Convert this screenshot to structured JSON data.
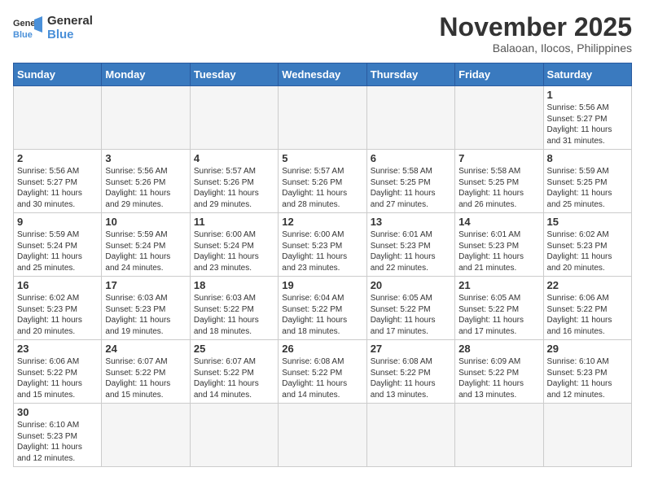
{
  "header": {
    "logo_general": "General",
    "logo_blue": "Blue",
    "month_year": "November 2025",
    "location": "Balaoan, Ilocos, Philippines"
  },
  "weekdays": [
    "Sunday",
    "Monday",
    "Tuesday",
    "Wednesday",
    "Thursday",
    "Friday",
    "Saturday"
  ],
  "weeks": [
    [
      {
        "day": "",
        "content": ""
      },
      {
        "day": "",
        "content": ""
      },
      {
        "day": "",
        "content": ""
      },
      {
        "day": "",
        "content": ""
      },
      {
        "day": "",
        "content": ""
      },
      {
        "day": "",
        "content": ""
      },
      {
        "day": "1",
        "content": "Sunrise: 5:56 AM\nSunset: 5:27 PM\nDaylight: 11 hours\nand 31 minutes."
      }
    ],
    [
      {
        "day": "2",
        "content": "Sunrise: 5:56 AM\nSunset: 5:27 PM\nDaylight: 11 hours\nand 30 minutes."
      },
      {
        "day": "3",
        "content": "Sunrise: 5:56 AM\nSunset: 5:26 PM\nDaylight: 11 hours\nand 29 minutes."
      },
      {
        "day": "4",
        "content": "Sunrise: 5:57 AM\nSunset: 5:26 PM\nDaylight: 11 hours\nand 29 minutes."
      },
      {
        "day": "5",
        "content": "Sunrise: 5:57 AM\nSunset: 5:26 PM\nDaylight: 11 hours\nand 28 minutes."
      },
      {
        "day": "6",
        "content": "Sunrise: 5:58 AM\nSunset: 5:25 PM\nDaylight: 11 hours\nand 27 minutes."
      },
      {
        "day": "7",
        "content": "Sunrise: 5:58 AM\nSunset: 5:25 PM\nDaylight: 11 hours\nand 26 minutes."
      },
      {
        "day": "8",
        "content": "Sunrise: 5:59 AM\nSunset: 5:25 PM\nDaylight: 11 hours\nand 25 minutes."
      }
    ],
    [
      {
        "day": "9",
        "content": "Sunrise: 5:59 AM\nSunset: 5:24 PM\nDaylight: 11 hours\nand 25 minutes."
      },
      {
        "day": "10",
        "content": "Sunrise: 5:59 AM\nSunset: 5:24 PM\nDaylight: 11 hours\nand 24 minutes."
      },
      {
        "day": "11",
        "content": "Sunrise: 6:00 AM\nSunset: 5:24 PM\nDaylight: 11 hours\nand 23 minutes."
      },
      {
        "day": "12",
        "content": "Sunrise: 6:00 AM\nSunset: 5:23 PM\nDaylight: 11 hours\nand 23 minutes."
      },
      {
        "day": "13",
        "content": "Sunrise: 6:01 AM\nSunset: 5:23 PM\nDaylight: 11 hours\nand 22 minutes."
      },
      {
        "day": "14",
        "content": "Sunrise: 6:01 AM\nSunset: 5:23 PM\nDaylight: 11 hours\nand 21 minutes."
      },
      {
        "day": "15",
        "content": "Sunrise: 6:02 AM\nSunset: 5:23 PM\nDaylight: 11 hours\nand 20 minutes."
      }
    ],
    [
      {
        "day": "16",
        "content": "Sunrise: 6:02 AM\nSunset: 5:23 PM\nDaylight: 11 hours\nand 20 minutes."
      },
      {
        "day": "17",
        "content": "Sunrise: 6:03 AM\nSunset: 5:23 PM\nDaylight: 11 hours\nand 19 minutes."
      },
      {
        "day": "18",
        "content": "Sunrise: 6:03 AM\nSunset: 5:22 PM\nDaylight: 11 hours\nand 18 minutes."
      },
      {
        "day": "19",
        "content": "Sunrise: 6:04 AM\nSunset: 5:22 PM\nDaylight: 11 hours\nand 18 minutes."
      },
      {
        "day": "20",
        "content": "Sunrise: 6:05 AM\nSunset: 5:22 PM\nDaylight: 11 hours\nand 17 minutes."
      },
      {
        "day": "21",
        "content": "Sunrise: 6:05 AM\nSunset: 5:22 PM\nDaylight: 11 hours\nand 17 minutes."
      },
      {
        "day": "22",
        "content": "Sunrise: 6:06 AM\nSunset: 5:22 PM\nDaylight: 11 hours\nand 16 minutes."
      }
    ],
    [
      {
        "day": "23",
        "content": "Sunrise: 6:06 AM\nSunset: 5:22 PM\nDaylight: 11 hours\nand 15 minutes."
      },
      {
        "day": "24",
        "content": "Sunrise: 6:07 AM\nSunset: 5:22 PM\nDaylight: 11 hours\nand 15 minutes."
      },
      {
        "day": "25",
        "content": "Sunrise: 6:07 AM\nSunset: 5:22 PM\nDaylight: 11 hours\nand 14 minutes."
      },
      {
        "day": "26",
        "content": "Sunrise: 6:08 AM\nSunset: 5:22 PM\nDaylight: 11 hours\nand 14 minutes."
      },
      {
        "day": "27",
        "content": "Sunrise: 6:08 AM\nSunset: 5:22 PM\nDaylight: 11 hours\nand 13 minutes."
      },
      {
        "day": "28",
        "content": "Sunrise: 6:09 AM\nSunset: 5:22 PM\nDaylight: 11 hours\nand 13 minutes."
      },
      {
        "day": "29",
        "content": "Sunrise: 6:10 AM\nSunset: 5:23 PM\nDaylight: 11 hours\nand 12 minutes."
      }
    ],
    [
      {
        "day": "30",
        "content": "Sunrise: 6:10 AM\nSunset: 5:23 PM\nDaylight: 11 hours\nand 12 minutes."
      },
      {
        "day": "",
        "content": ""
      },
      {
        "day": "",
        "content": ""
      },
      {
        "day": "",
        "content": ""
      },
      {
        "day": "",
        "content": ""
      },
      {
        "day": "",
        "content": ""
      },
      {
        "day": "",
        "content": ""
      }
    ]
  ]
}
